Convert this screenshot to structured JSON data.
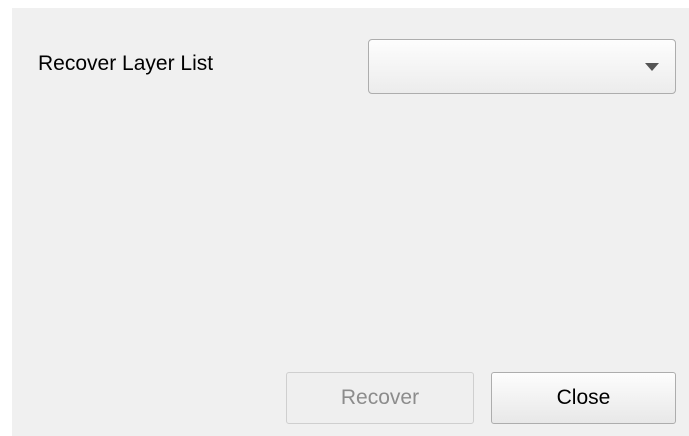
{
  "form": {
    "recover_layer_list_label": "Recover Layer List",
    "recover_layer_list_value": ""
  },
  "buttons": {
    "recover_label": "Recover",
    "recover_enabled": false,
    "close_label": "Close",
    "close_enabled": true
  },
  "icons": {
    "dropdown": "chevron-down-icon"
  }
}
